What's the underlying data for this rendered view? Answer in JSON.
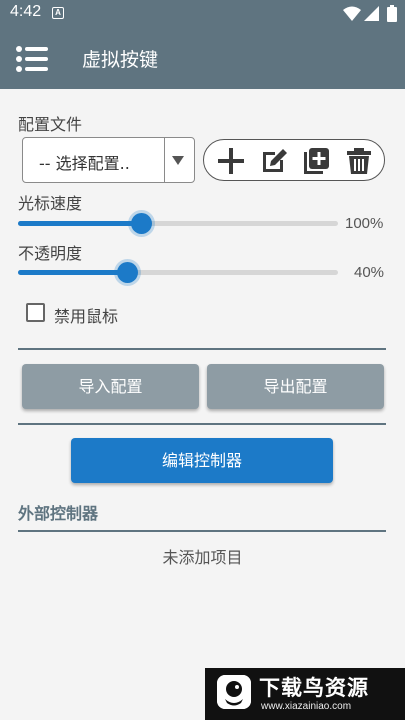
{
  "status_bar": {
    "time": "4:42",
    "notification_glyph": "A",
    "icons": [
      "wifi-icon",
      "signal-icon",
      "battery-icon"
    ]
  },
  "app_bar": {
    "title": "虚拟按键",
    "menu_icon": "menu-icon"
  },
  "config": {
    "label": "配置文件",
    "select_value": "-- 选择配置..",
    "tools": [
      "add-icon",
      "edit-icon",
      "copy-icon",
      "delete-icon"
    ]
  },
  "cursor_speed": {
    "label": "光标速度",
    "value": 1.0,
    "display": "100%"
  },
  "opacity": {
    "label": "不透明度",
    "value": 0.4,
    "display": "40%"
  },
  "disable_mouse": {
    "label": "禁用鼠标",
    "checked": false
  },
  "actions": {
    "import_label": "导入配置",
    "export_label": "导出配置",
    "edit_controller_label": "编辑控制器"
  },
  "external_controllers": {
    "title": "外部控制器",
    "empty_text": "未添加项目"
  },
  "watermark": {
    "title": "下载鸟资源",
    "url": "www.xiazainiao.com"
  },
  "colors": {
    "app_bar": "#5f7480",
    "accent": "#1c7ac8",
    "button_gray": "#8e9ca4",
    "background": "#f4f4f4"
  }
}
